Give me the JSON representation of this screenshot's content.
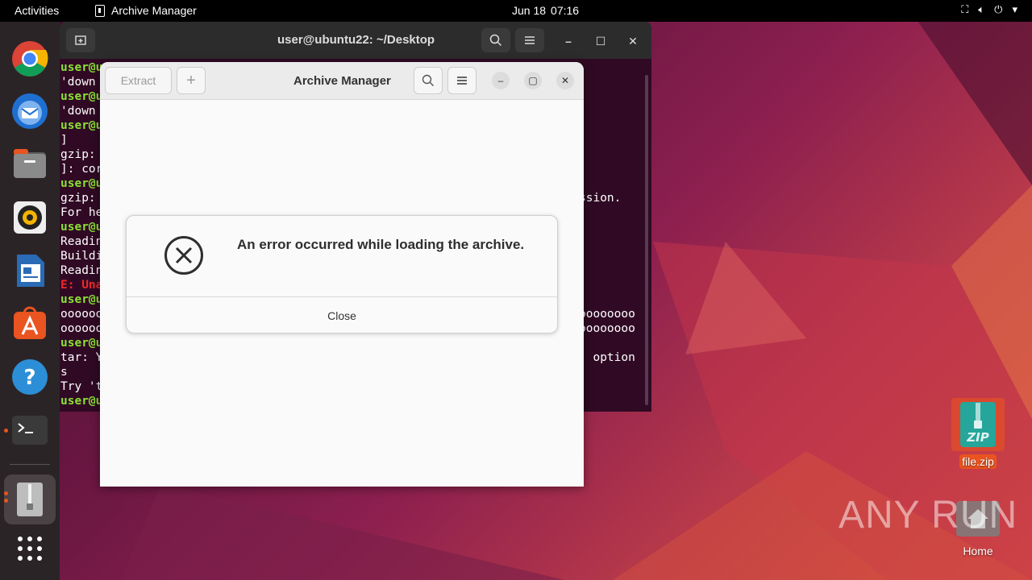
{
  "topbar": {
    "activities": "Activities",
    "app_name": "Archive Manager",
    "date": "Jun 18",
    "time": "07:16"
  },
  "dock": {
    "items": [
      "Google Chrome",
      "Thunderbird Mail",
      "Files",
      "Rhythmbox",
      "LibreOffice Writer",
      "Ubuntu Software",
      "Help",
      "Terminal",
      "Archive Manager",
      "Show Applications"
    ]
  },
  "terminal": {
    "title": "user@ubuntu22: ~/Desktop",
    "lines": [
      {
        "cls": "g",
        "text": "user@u"
      },
      {
        "cls": "",
        "text": "'down"
      },
      {
        "cls": "g",
        "text": "user@u"
      },
      {
        "cls": "",
        "text": "'down"
      },
      {
        "cls": "g",
        "text": "user@u"
      },
      {
        "cls": "",
        "text": "]"
      },
      {
        "cls": "",
        "text": "gzip:"
      },
      {
        "cls": "",
        "text": "]: cor"
      },
      {
        "cls": "g",
        "text": "user@u"
      },
      {
        "cls": "",
        "text": "gzip:"
      },
      {
        "cls": "",
        "text": "For he"
      },
      {
        "cls": "g",
        "text": "user@u"
      },
      {
        "cls": "",
        "text": "Readin"
      },
      {
        "cls": "",
        "text": "Buildi"
      },
      {
        "cls": "",
        "text": "Readin"
      },
      {
        "cls": "r",
        "text": "E: Una"
      },
      {
        "cls": "g",
        "text": "user@u"
      },
      {
        "cls": "",
        "text": "oooooo"
      },
      {
        "cls": "",
        "text": "oooooo"
      },
      {
        "cls": "g",
        "text": "user@u"
      },
      {
        "cls": "",
        "text": "tar: Y"
      },
      {
        "cls": "",
        "text": "s"
      },
      {
        "cls": "",
        "text": "Try 't"
      },
      {
        "cls": "g",
        "text": "user@u"
      }
    ],
    "right_fragments": [
      {
        "row": 9,
        "text": "ssion."
      },
      {
        "row": 17,
        "text": "oooooooo"
      },
      {
        "row": 18,
        "text": "oooooooo"
      },
      {
        "row": 20,
        "text": "' option"
      }
    ]
  },
  "archive_manager": {
    "title": "Archive Manager",
    "extract_label": "Extract",
    "add_label": "+"
  },
  "error_dialog": {
    "message": "An error occurred while loading the archive.",
    "close_label": "Close"
  },
  "desktop": {
    "zip_file_label": "file.zip",
    "zip_badge": "ZIP",
    "home_label": "Home",
    "watermark": "ANY RUN"
  },
  "colors": {
    "ubuntu_orange": "#e95420",
    "terminal_bg": "#300a24",
    "prompt_green": "#8ae234"
  }
}
